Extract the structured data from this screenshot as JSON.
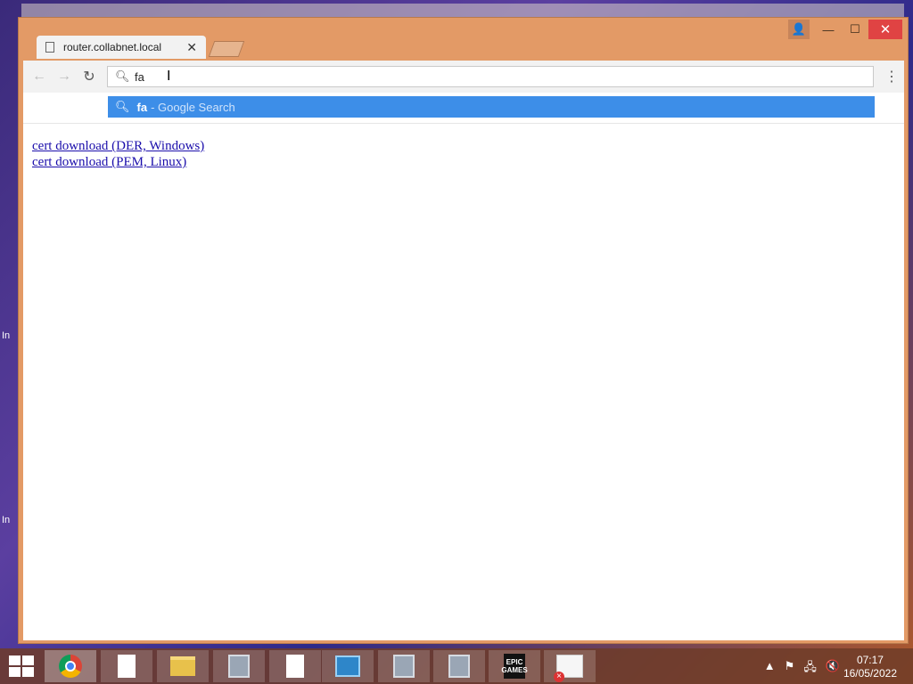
{
  "browser": {
    "tab": {
      "title": "router.collabnet.local",
      "close_glyph": "✕"
    },
    "nav": {
      "back_glyph": "←",
      "forward_glyph": "→",
      "reload_glyph": "↻",
      "menu_glyph": "⋮"
    },
    "omnibox": {
      "value": "fa"
    },
    "suggestion": {
      "query": "fa",
      "hint": "- Google Search"
    },
    "window_controls": {
      "profile_glyph": "👤",
      "minimize": "—",
      "maximize": "☐",
      "close": "✕"
    }
  },
  "page": {
    "links": [
      "cert download (DER, Windows)",
      "cert download (PEM, Linux)"
    ]
  },
  "desktop": {
    "fragment_1": "In",
    "fragment_2": "In"
  },
  "taskbar": {
    "epic_label": "EPIC GAMES",
    "tray": {
      "chevron": "▲",
      "flag": "⚑",
      "network": "🖧",
      "volume": "🔇"
    },
    "clock": {
      "time": "07:17",
      "date": "16/05/2022"
    }
  },
  "colors": {
    "accent": "#3d8ee8",
    "window_frame": "#e39a66",
    "link": "#1a0dab"
  }
}
